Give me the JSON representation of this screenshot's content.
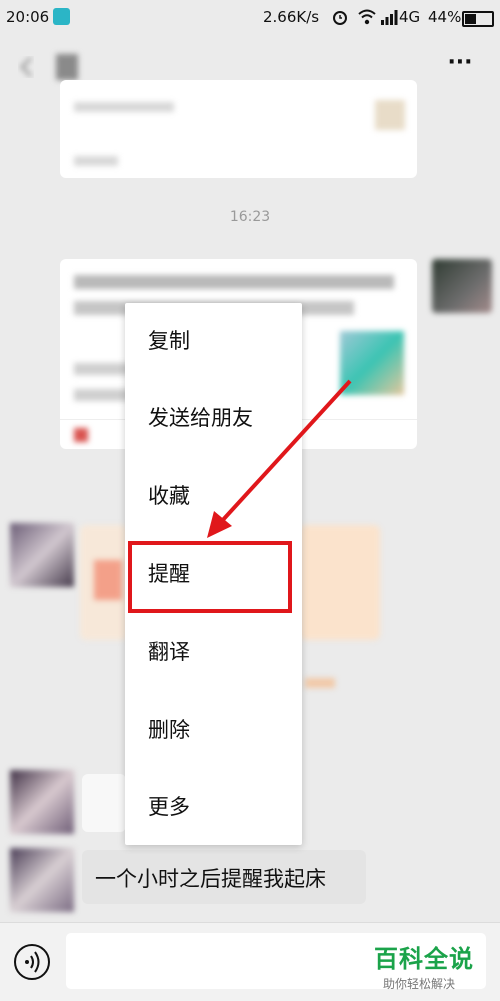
{
  "status": {
    "time": "20:06",
    "speed": "2.66K/s",
    "network": "4G",
    "battery": "44%"
  },
  "header": {
    "more_label": "···"
  },
  "chat": {
    "timestamp": "16:23",
    "last_message": "一个小时之后提醒我起床"
  },
  "menu": {
    "items": [
      "复制",
      "发送给朋友",
      "收藏",
      "提醒",
      "翻译",
      "删除",
      "更多"
    ],
    "highlighted_index": 3
  },
  "watermark": {
    "title": "百科全说",
    "subtitle": "助你轻松解决"
  },
  "colors": {
    "accent_red": "#e0171b",
    "watermark_green": "#1ba34a"
  },
  "icons": {
    "back": "chevron-left-icon",
    "more": "more-dots-icon",
    "voice": "voice-icon",
    "screenshot": "screenshot-icon",
    "alarm": "alarm-icon",
    "wifi": "wifi-icon",
    "signal": "signal-icon",
    "battery": "battery-icon"
  }
}
